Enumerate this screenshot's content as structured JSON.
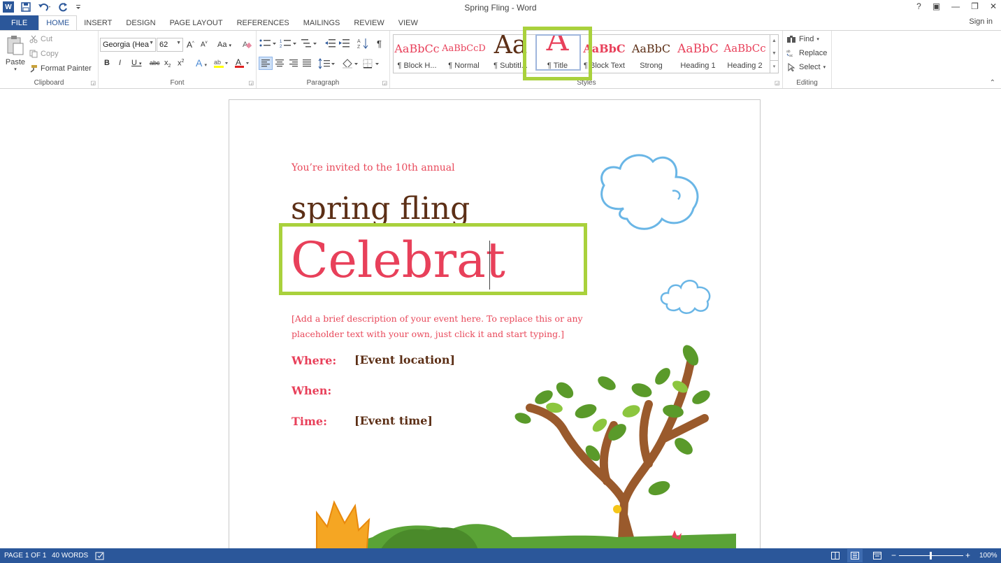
{
  "app": {
    "title": "Spring Fling - Word",
    "logo_letter": "W",
    "signin": "Sign in",
    "help": "?",
    "window_controls": [
      "?",
      "▣",
      "—",
      "❐",
      "✕"
    ]
  },
  "tabs": [
    {
      "label": "FILE"
    },
    {
      "label": "HOME"
    },
    {
      "label": "INSERT"
    },
    {
      "label": "DESIGN"
    },
    {
      "label": "PAGE LAYOUT"
    },
    {
      "label": "REFERENCES"
    },
    {
      "label": "MAILINGS"
    },
    {
      "label": "REVIEW"
    },
    {
      "label": "VIEW"
    }
  ],
  "clipboard": {
    "group_label": "Clipboard",
    "paste": "Paste",
    "cut": "Cut",
    "copy": "Copy",
    "format_painter": "Format Painter"
  },
  "font": {
    "group_label": "Font",
    "font_name": "Georgia (Hea",
    "font_size": "62",
    "change_case": "Aa"
  },
  "paragraph": {
    "group_label": "Paragraph"
  },
  "styles": {
    "group_label": "Styles",
    "items": [
      {
        "sample": "AaBbCc",
        "name": "¶ Block H..."
      },
      {
        "sample": "AaBbCcD",
        "name": "¶ Normal"
      },
      {
        "sample": "Aa",
        "name": "¶ Subtitl..."
      },
      {
        "sample": "A",
        "name": "¶ Title"
      },
      {
        "sample": "AaBbC",
        "name": "¶ Block Text"
      },
      {
        "sample": "AaBbC",
        "name": "Strong"
      },
      {
        "sample": "AaBbC",
        "name": "Heading 1"
      },
      {
        "sample": "AaBbCc",
        "name": "Heading 2"
      }
    ]
  },
  "editing": {
    "group_label": "Editing",
    "find": "Find",
    "replace": "Replace",
    "select": "Select"
  },
  "document": {
    "invite": "You’re invited to the 10th annual",
    "spring": "spring fling",
    "celebrate": "Celebrat",
    "description": "[Add a brief description of your event here. To replace this or any placeholder text with your own, just click it and start typing.]",
    "where_label": "Where:",
    "where_value": "[Event location]",
    "when_label": "When:",
    "time_label": "Time:",
    "time_value": "[Event time]"
  },
  "status": {
    "page": "PAGE 1 OF 1",
    "words": "40 WORDS",
    "zoom": "100%"
  },
  "colors": {
    "accent": "#2b579a",
    "highlight": "#a9d13c",
    "title_red": "#e8405a",
    "brown": "#5c2f16"
  }
}
